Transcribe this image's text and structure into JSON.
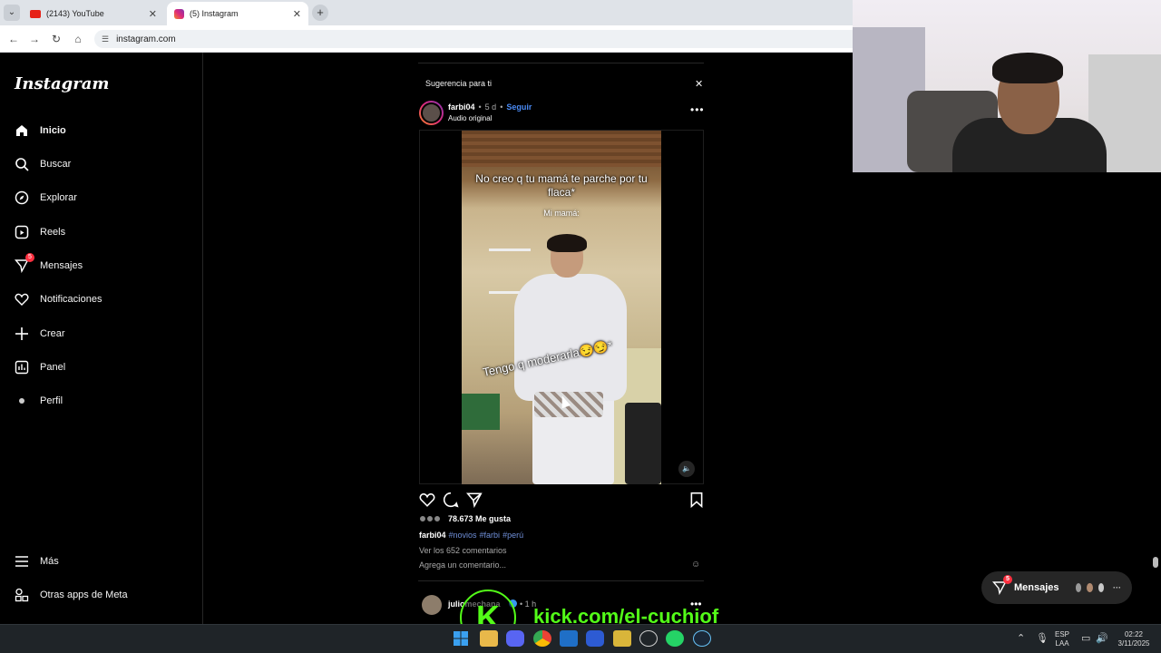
{
  "browser": {
    "tabs": [
      {
        "title": "(2143) YouTube"
      },
      {
        "title": "(5) Instagram"
      }
    ],
    "url": "instagram.com"
  },
  "sidebar": {
    "logo": "Instagram",
    "items": [
      {
        "label": "Inicio",
        "icon": "home-icon"
      },
      {
        "label": "Buscar",
        "icon": "search-icon"
      },
      {
        "label": "Explorar",
        "icon": "compass-icon"
      },
      {
        "label": "Reels",
        "icon": "reels-icon"
      },
      {
        "label": "Mensajes",
        "icon": "messenger-icon",
        "badge": "5"
      },
      {
        "label": "Notificaciones",
        "icon": "heart-icon"
      },
      {
        "label": "Crear",
        "icon": "plus-icon"
      },
      {
        "label": "Panel",
        "icon": "chart-icon"
      },
      {
        "label": "Perfil",
        "icon": "avatar-icon"
      }
    ],
    "bottom": [
      {
        "label": "Más",
        "icon": "menu-icon"
      },
      {
        "label": "Otras apps de Meta",
        "icon": "meta-apps-icon"
      }
    ]
  },
  "post": {
    "suggestion_label": "Sugerencia para ti",
    "username": "farbi04",
    "separator": "•",
    "time": "5 d",
    "follow_label": "Seguir",
    "audio": "Audio original",
    "video_caption_top": "No creo q tu mamá te parche por tu flaca*",
    "video_caption_mid": "Mi mamá:",
    "video_caption_bottom": "Tengo q moderarla😏😏*",
    "likes": "78.673 Me gusta",
    "caption_user": "farbi04",
    "hashtags": [
      "#novios",
      "#farbi",
      "#perú"
    ],
    "view_comments": "Ver los 652 comentarios",
    "add_comment_placeholder": "Agrega un comentario..."
  },
  "next_post": {
    "username": "juliomechana",
    "time": "• 1 h"
  },
  "messages_pill": {
    "label": "Mensajes",
    "badge": "5",
    "more": "···"
  },
  "stream_overlay": {
    "logo_letter": "K",
    "text": "kick.com/el-cuchiof"
  },
  "taskbar": {
    "lang_top": "ESP",
    "lang_bottom": "LAA",
    "time": "02:22",
    "date": "3/11/2025"
  },
  "colors": {
    "follow_blue": "#4a8af4",
    "kick_green": "#53fc18",
    "badge_red": "#ff3040"
  }
}
